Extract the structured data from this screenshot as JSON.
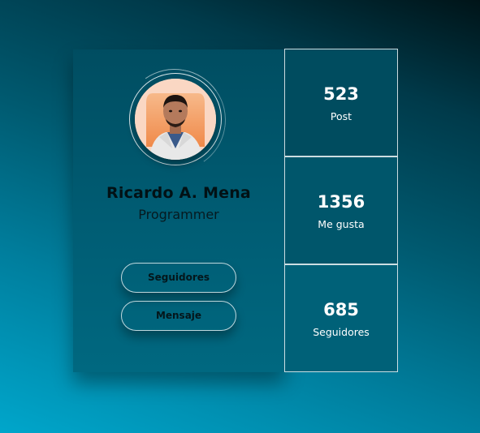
{
  "profile": {
    "name": "Ricardo A. Mena",
    "role": "Programmer",
    "avatar_icon": "profile-photo"
  },
  "actions": {
    "followers_label": "Seguidores",
    "message_label": "Mensaje"
  },
  "stats": [
    {
      "value": "523",
      "label": "Post"
    },
    {
      "value": "1356",
      "label": "Me gusta"
    },
    {
      "value": "685",
      "label": "Seguidores"
    }
  ],
  "colors": {
    "background_light": "#00a6cb",
    "background_dark": "#001418",
    "card": "#005a70",
    "avatar_bg": "#fad7c3",
    "text_dark": "#021115",
    "text_light": "#ffffff"
  }
}
